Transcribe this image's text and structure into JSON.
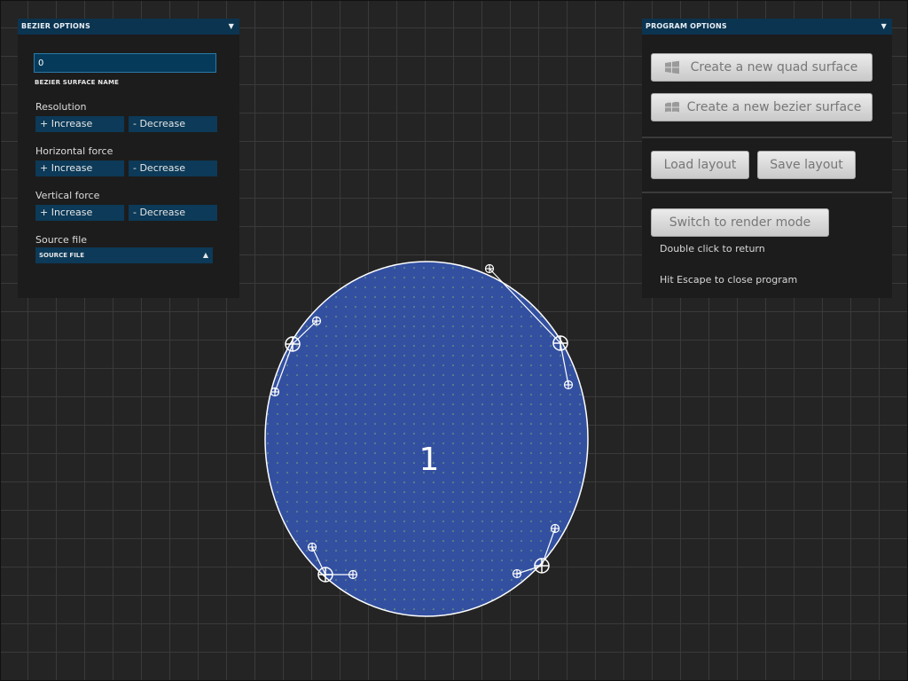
{
  "bezier_panel": {
    "title": "BEZIER OPTIONS",
    "name_value": "0",
    "name_caption": "BEZIER SURFACE NAME",
    "resolution_label": "Resolution",
    "horizontal_label": "Horizontal force",
    "vertical_label": "Vertical force",
    "increase_label": "+ Increase",
    "decrease_label": "- Decrease",
    "source_label": "Source file",
    "source_value": "SOURCE FILE"
  },
  "program_panel": {
    "title": "PROGRAM OPTIONS",
    "quad_button": "Create a new quad surface",
    "bezier_button": "Create a new bezier surface",
    "load_button": "Load layout",
    "save_button": "Save layout",
    "render_button": "Switch to render mode",
    "double_click_hint": "Double click to return",
    "escape_hint": "Hit Escape to close program"
  },
  "surface": {
    "label": "1",
    "fill_color": "#3350a0",
    "dot_color": "#9acb6a"
  },
  "icons": {
    "dropdown": "triangle-down-icon",
    "windows": "windows-logo-icon",
    "handle": "crosshair-handle-icon"
  }
}
